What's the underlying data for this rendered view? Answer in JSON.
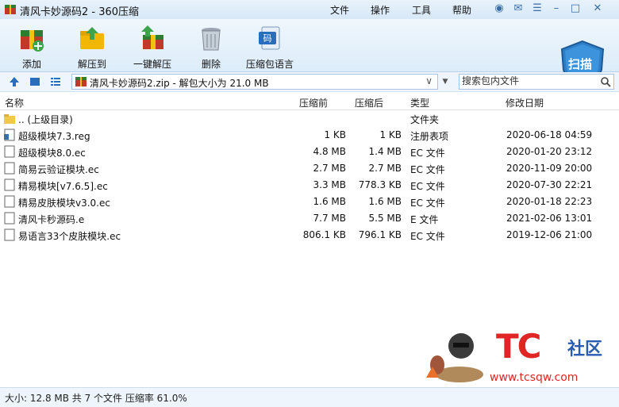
{
  "window": {
    "title": "清风卡妙源码2 - 360压缩",
    "menus": [
      "文件",
      "操作",
      "工具",
      "帮助"
    ]
  },
  "toolbar": {
    "add": "添加",
    "extract_to": "解压到",
    "one_click_extract": "一键解压",
    "delete": "删除",
    "compress_eyuyan": "压缩包语言",
    "scan": "扫描"
  },
  "address": {
    "path": "清风卡妙源码2.zip - 解包大小为 21.0 MB",
    "search_placeholder": "搜索包内文件"
  },
  "columns": {
    "name": "名称",
    "compressed": "压缩前",
    "after": "压缩后",
    "type": "类型",
    "modified": "修改日期"
  },
  "files": [
    {
      "name": ".. (上级目录)",
      "before": "",
      "after": "",
      "type": "文件夹",
      "date": "",
      "icon": "folder-icon"
    },
    {
      "name": "超级模块7.3.reg",
      "before": "1 KB",
      "after": "1 KB",
      "type": "注册表项",
      "date": "2020-06-18 04:59",
      "icon": "reg-file-icon"
    },
    {
      "name": "超级模块8.0.ec",
      "before": "4.8 MB",
      "after": "1.4 MB",
      "type": "EC 文件",
      "date": "2020-01-20 23:12",
      "icon": "file-icon"
    },
    {
      "name": "简易云验证模块.ec",
      "before": "2.7 MB",
      "after": "2.7 MB",
      "type": "EC 文件",
      "date": "2020-11-09 20:00",
      "icon": "file-icon"
    },
    {
      "name": "精易模块[v7.6.5].ec",
      "before": "3.3 MB",
      "after": "778.3 KB",
      "type": "EC 文件",
      "date": "2020-07-30 22:21",
      "icon": "file-icon"
    },
    {
      "name": "精易皮肤模块v3.0.ec",
      "before": "1.6 MB",
      "after": "1.6 MB",
      "type": "EC 文件",
      "date": "2020-01-18 22:23",
      "icon": "file-icon"
    },
    {
      "name": "清风卡秒源码.e",
      "before": "7.7 MB",
      "after": "5.5 MB",
      "type": "E 文件",
      "date": "2021-02-06 13:01",
      "icon": "file-icon"
    },
    {
      "name": "易语言33个皮肤模块.ec",
      "before": "806.1 KB",
      "after": "796.1 KB",
      "type": "EC 文件",
      "date": "2019-12-06 21:00",
      "icon": "file-icon"
    }
  ],
  "status": {
    "text": "大小: 12.8 MB 共 7 个文件 压缩率 61.0%"
  },
  "watermark": {
    "brand": "TC",
    "suffix": "社区",
    "url": "www.tcsqw.com"
  },
  "colors": {
    "accent": "#2a6ebb",
    "brand_red": "#e02525"
  }
}
